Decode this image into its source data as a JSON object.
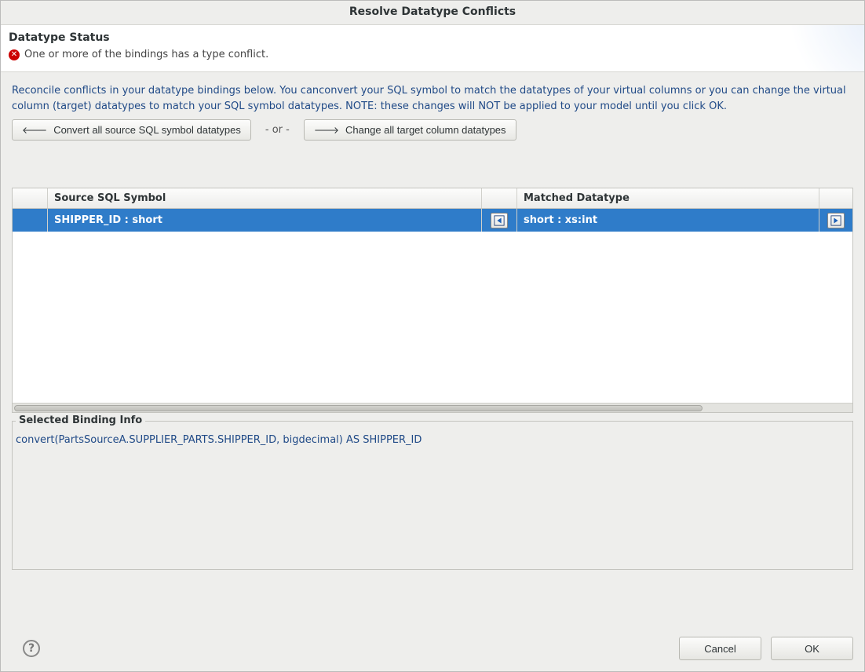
{
  "dialog": {
    "title": "Resolve Datatype Conflicts"
  },
  "header": {
    "section_title": "Datatype Status",
    "status_message": "One or more of the bindings has a type conflict."
  },
  "instructions": "Reconcile conflicts in your datatype bindings below. You canconvert your SQL symbol to match the datatypes of your virtual columns or you can change the virtual column (target) datatypes to match your SQL symbol datatypes. NOTE: these changes will NOT be applied to your model until you click OK.",
  "buttons": {
    "convert_all_source": "Convert all source SQL symbol datatypes",
    "or_separator": "- or -",
    "change_all_target": "Change all target column datatypes"
  },
  "table": {
    "columns": {
      "source": "Source SQL Symbol",
      "matched": "Matched Datatype"
    },
    "rows": [
      {
        "source": "SHIPPER_ID : short",
        "matched": "short : xs:int"
      }
    ]
  },
  "binding_info": {
    "legend": "Selected Binding Info",
    "text": "convert(PartsSourceA.SUPPLIER_PARTS.SHIPPER_ID, bigdecimal) AS SHIPPER_ID"
  },
  "footer": {
    "cancel": "Cancel",
    "ok": "OK"
  }
}
